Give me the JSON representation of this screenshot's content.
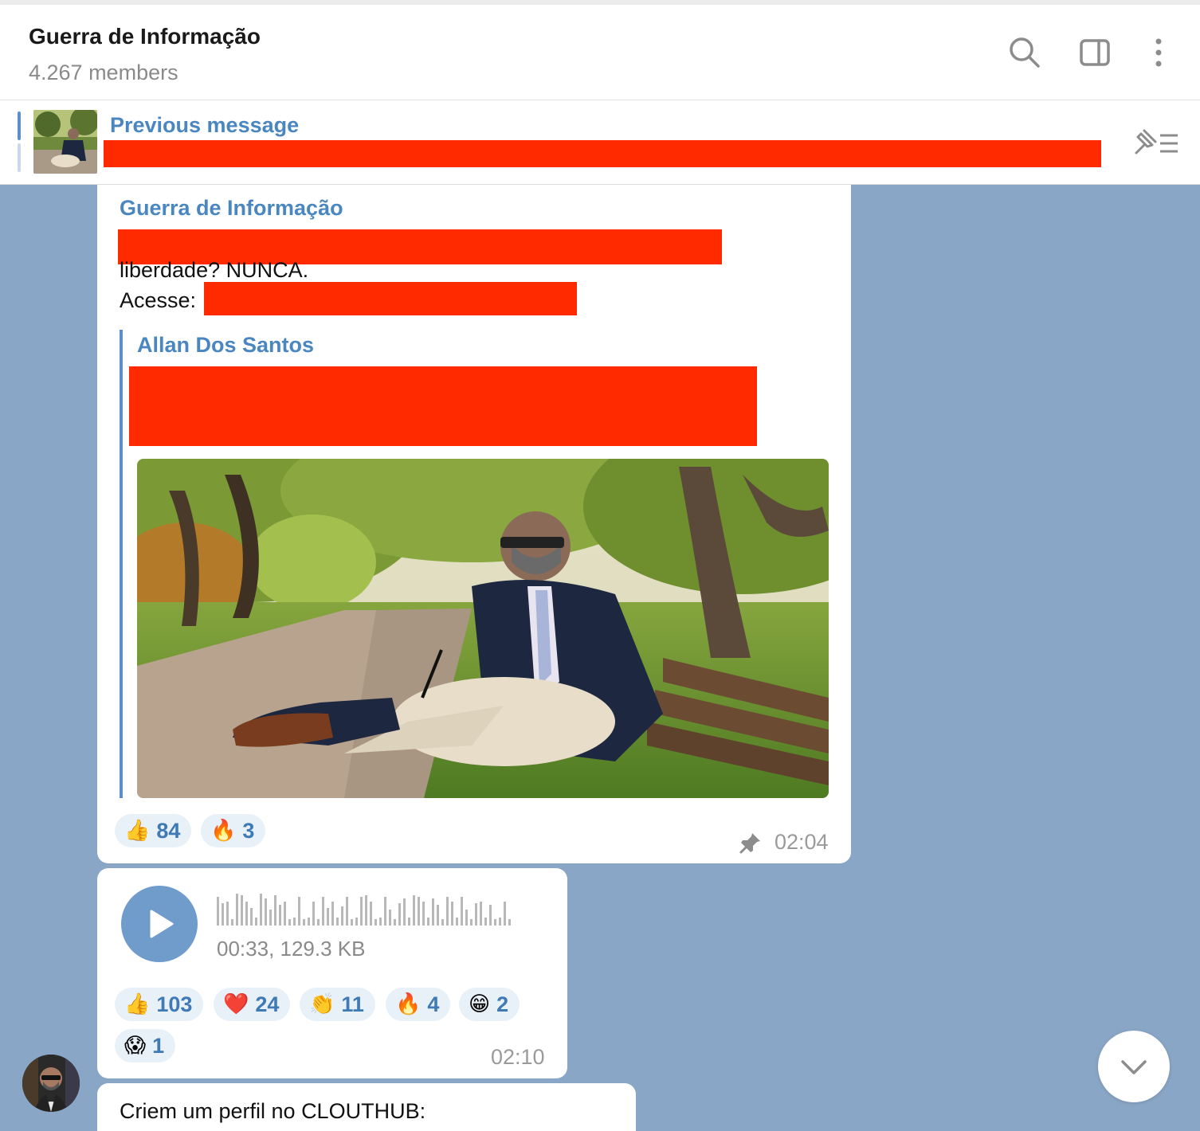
{
  "header": {
    "title": "Guerra de Informação",
    "members": "4.267 members",
    "icons": [
      "search-icon",
      "sidebar-toggle-icon",
      "more-vertical-icon"
    ]
  },
  "pinned": {
    "label": "Previous message",
    "icon": "pinned-list-icon"
  },
  "messages": {
    "forward": {
      "sender": "Guerra de Informação",
      "line2": "liberdade? NUNCA.",
      "line3_prefix": "Acesse:",
      "quote_author": "Allan Dos Santos",
      "reactions": [
        {
          "emoji": "👍",
          "count": "84"
        },
        {
          "emoji": "🔥",
          "count": "3"
        }
      ],
      "time": "02:04",
      "pinned_icon": "pin-icon"
    },
    "voice": {
      "meta": "00:33, 129.3 KB",
      "reactions": [
        {
          "emoji": "👍",
          "count": "103"
        },
        {
          "emoji": "❤️",
          "count": "24"
        },
        {
          "emoji": "👏",
          "count": "11"
        },
        {
          "emoji": "🔥",
          "count": "4"
        },
        {
          "emoji": "😁",
          "count": "2"
        },
        {
          "emoji": "😱",
          "count": "1"
        }
      ],
      "time": "02:10"
    },
    "last": {
      "text": "Criem um perfil no CLOUTHUB:"
    }
  },
  "colors": {
    "accent": "#4a86c0",
    "chat_background": "#8aa6c6",
    "redaction": "#ff2a00",
    "reaction_bg": "#e8f0f8"
  }
}
